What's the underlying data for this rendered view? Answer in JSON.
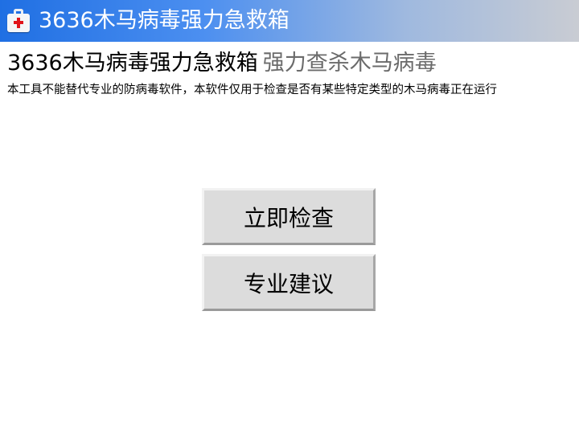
{
  "window": {
    "title": "3636木马病毒强力急救箱",
    "icon": "first-aid-kit-icon",
    "titlebar_gradient": [
      "#1f6fe3",
      "#c9ccd3"
    ]
  },
  "header": {
    "title": "3636木马病毒强力急救箱",
    "subtitle": "强力查杀木马病毒",
    "description": "本工具不能替代专业的防病毒软件，本软件仅用于检查是否有某些特定类型的木马病毒正在运行"
  },
  "actions": {
    "check_now_label": "立即检查",
    "advice_label": "专业建议"
  }
}
